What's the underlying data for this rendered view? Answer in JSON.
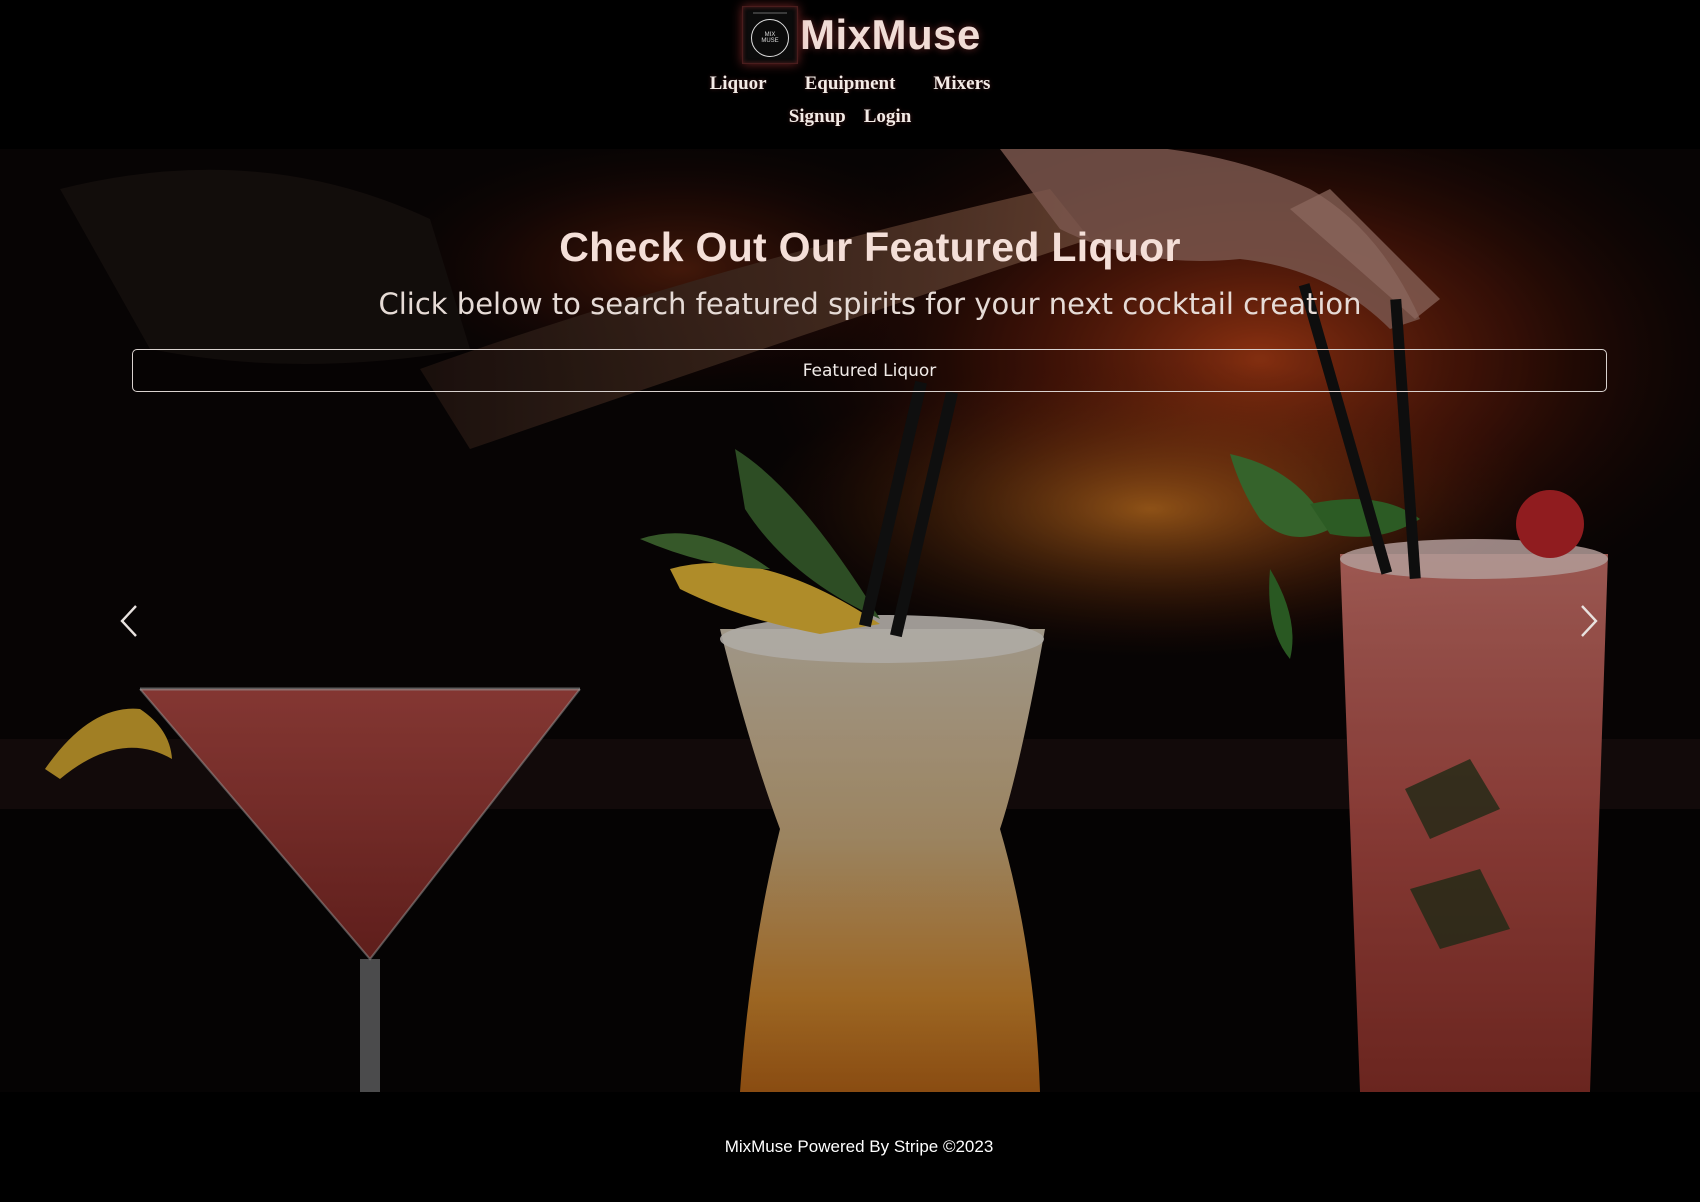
{
  "brand": {
    "name": "MixMuse",
    "logo_lines": [
      "MIX",
      "MUSE"
    ]
  },
  "nav": {
    "primary": [
      {
        "label": "Liquor"
      },
      {
        "label": "Equipment"
      },
      {
        "label": "Mixers"
      }
    ],
    "account": [
      {
        "label": "Signup"
      },
      {
        "label": "Login"
      }
    ]
  },
  "hero": {
    "title": "Check Out Our Featured Liquor",
    "subtitle": "Click below to search featured spirits for your next cocktail creation",
    "button_label": "Featured Liquor",
    "background_image": "cocktails-on-bar-photo",
    "carousel": {
      "prev_icon": "chevron-left-icon",
      "next_icon": "chevron-right-icon"
    }
  },
  "footer": {
    "text": "MixMuse Powered By Stripe ©2023"
  },
  "colors": {
    "page_background": "#000000",
    "brand_text": "#f1dcd6",
    "logo_glow": "#be3c3c",
    "nav_text": "#f3ebe6",
    "hero_title": "#f4dfd8",
    "button_border": "#d9d2cf",
    "footer_text": "#ffffff"
  }
}
